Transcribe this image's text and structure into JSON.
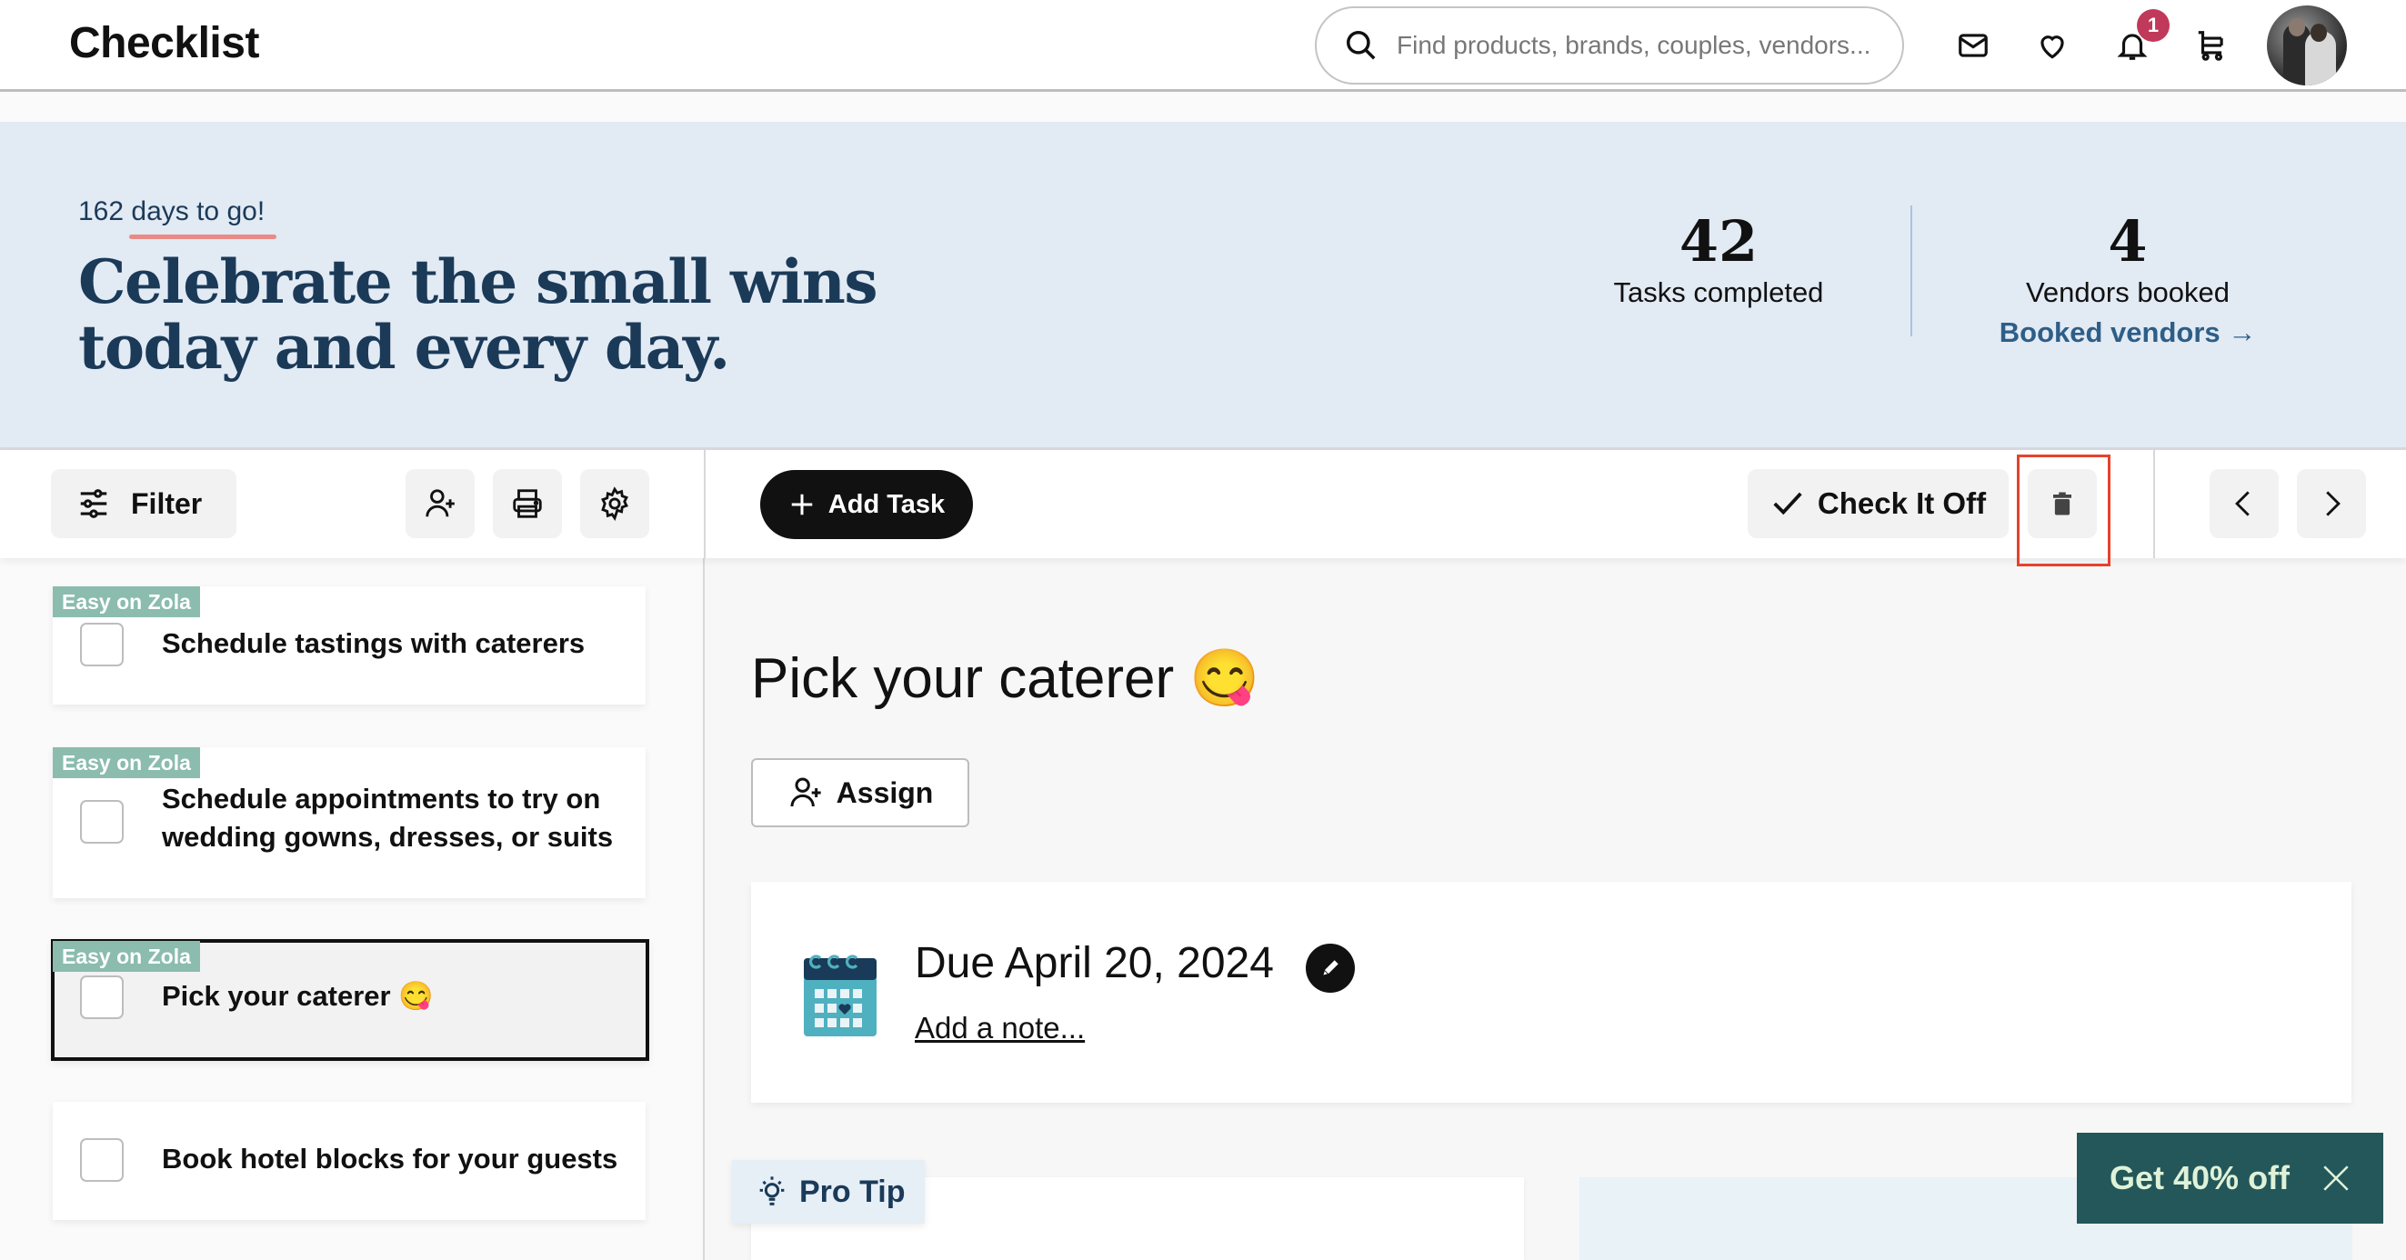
{
  "header": {
    "title": "Checklist",
    "search_placeholder": "Find products, brands, couples, vendors...",
    "icons": [
      "mail-icon",
      "heart-icon",
      "bell-icon",
      "cart-icon"
    ],
    "notification_count": "1",
    "badge_color": "#c0395a"
  },
  "hero": {
    "countdown": "162 days to go!",
    "headline": "Celebrate the small wins today and every day.",
    "stats": [
      {
        "value": "42",
        "label": "Tasks completed"
      },
      {
        "value": "4",
        "label": "Vendors booked"
      }
    ],
    "booked_vendors_link": "Booked vendors →",
    "background": "#e2eaf4",
    "accent": "#1b3a58"
  },
  "toolbar": {
    "filter_label": "Filter",
    "add_task_label": "Add Task",
    "check_off_label": "Check It Off",
    "icon_buttons": [
      "assign-user-icon",
      "printer-icon",
      "gear-icon",
      "trash-icon",
      "chevron-left-icon",
      "chevron-right-icon"
    ]
  },
  "tasks": [
    {
      "tag": "Easy on Zola",
      "title": "Schedule tastings with caterers",
      "checked": false,
      "selected": false
    },
    {
      "tag": "Easy on Zola",
      "title": "Schedule appointments to try on wedding gowns, dresses, or suits",
      "checked": false,
      "selected": false
    },
    {
      "tag": "Easy on Zola",
      "title": "Pick your caterer 😋",
      "checked": false,
      "selected": true
    },
    {
      "tag": "",
      "title": "Book hotel blocks for your guests",
      "checked": false,
      "selected": false
    }
  ],
  "detail": {
    "title": "Pick your caterer 😋",
    "assign_label": "Assign",
    "due_text": "Due April 20, 2024",
    "add_note_label": "Add a note...",
    "pro_tip_label": "Pro Tip"
  },
  "promo": {
    "label": "Get 40% off",
    "color": "#23575a"
  }
}
